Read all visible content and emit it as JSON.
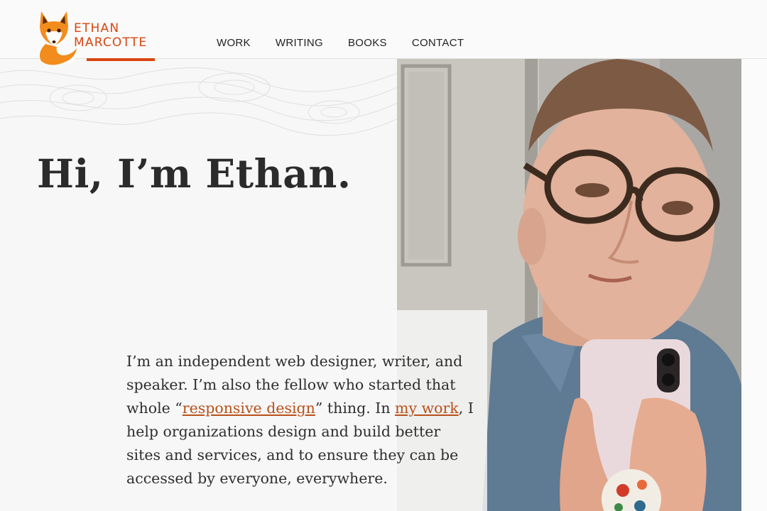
{
  "brand": {
    "line1": "ETHAN",
    "line2": "MARCOTTE"
  },
  "nav": [
    "WORK",
    "WRITING",
    "BOOKS",
    "CONTACT"
  ],
  "hero": {
    "headline": "Hi, I’m Ethan."
  },
  "intro": {
    "p1": "I’m an independent web designer, writer, and speaker. I’m also the fellow who started that whole “",
    "link1": "responsive design",
    "p2": "” thing. In ",
    "link2": "my work",
    "p3": ", I help organizations design and build better sites and services, and to ensure they can be accessed by everyone, everywhere."
  },
  "colors": {
    "accent": "#d9450f",
    "link": "#b8511a",
    "text": "#2b2b2b",
    "background": "#f7f7f7"
  },
  "icons": [
    "fox-logo-icon"
  ]
}
